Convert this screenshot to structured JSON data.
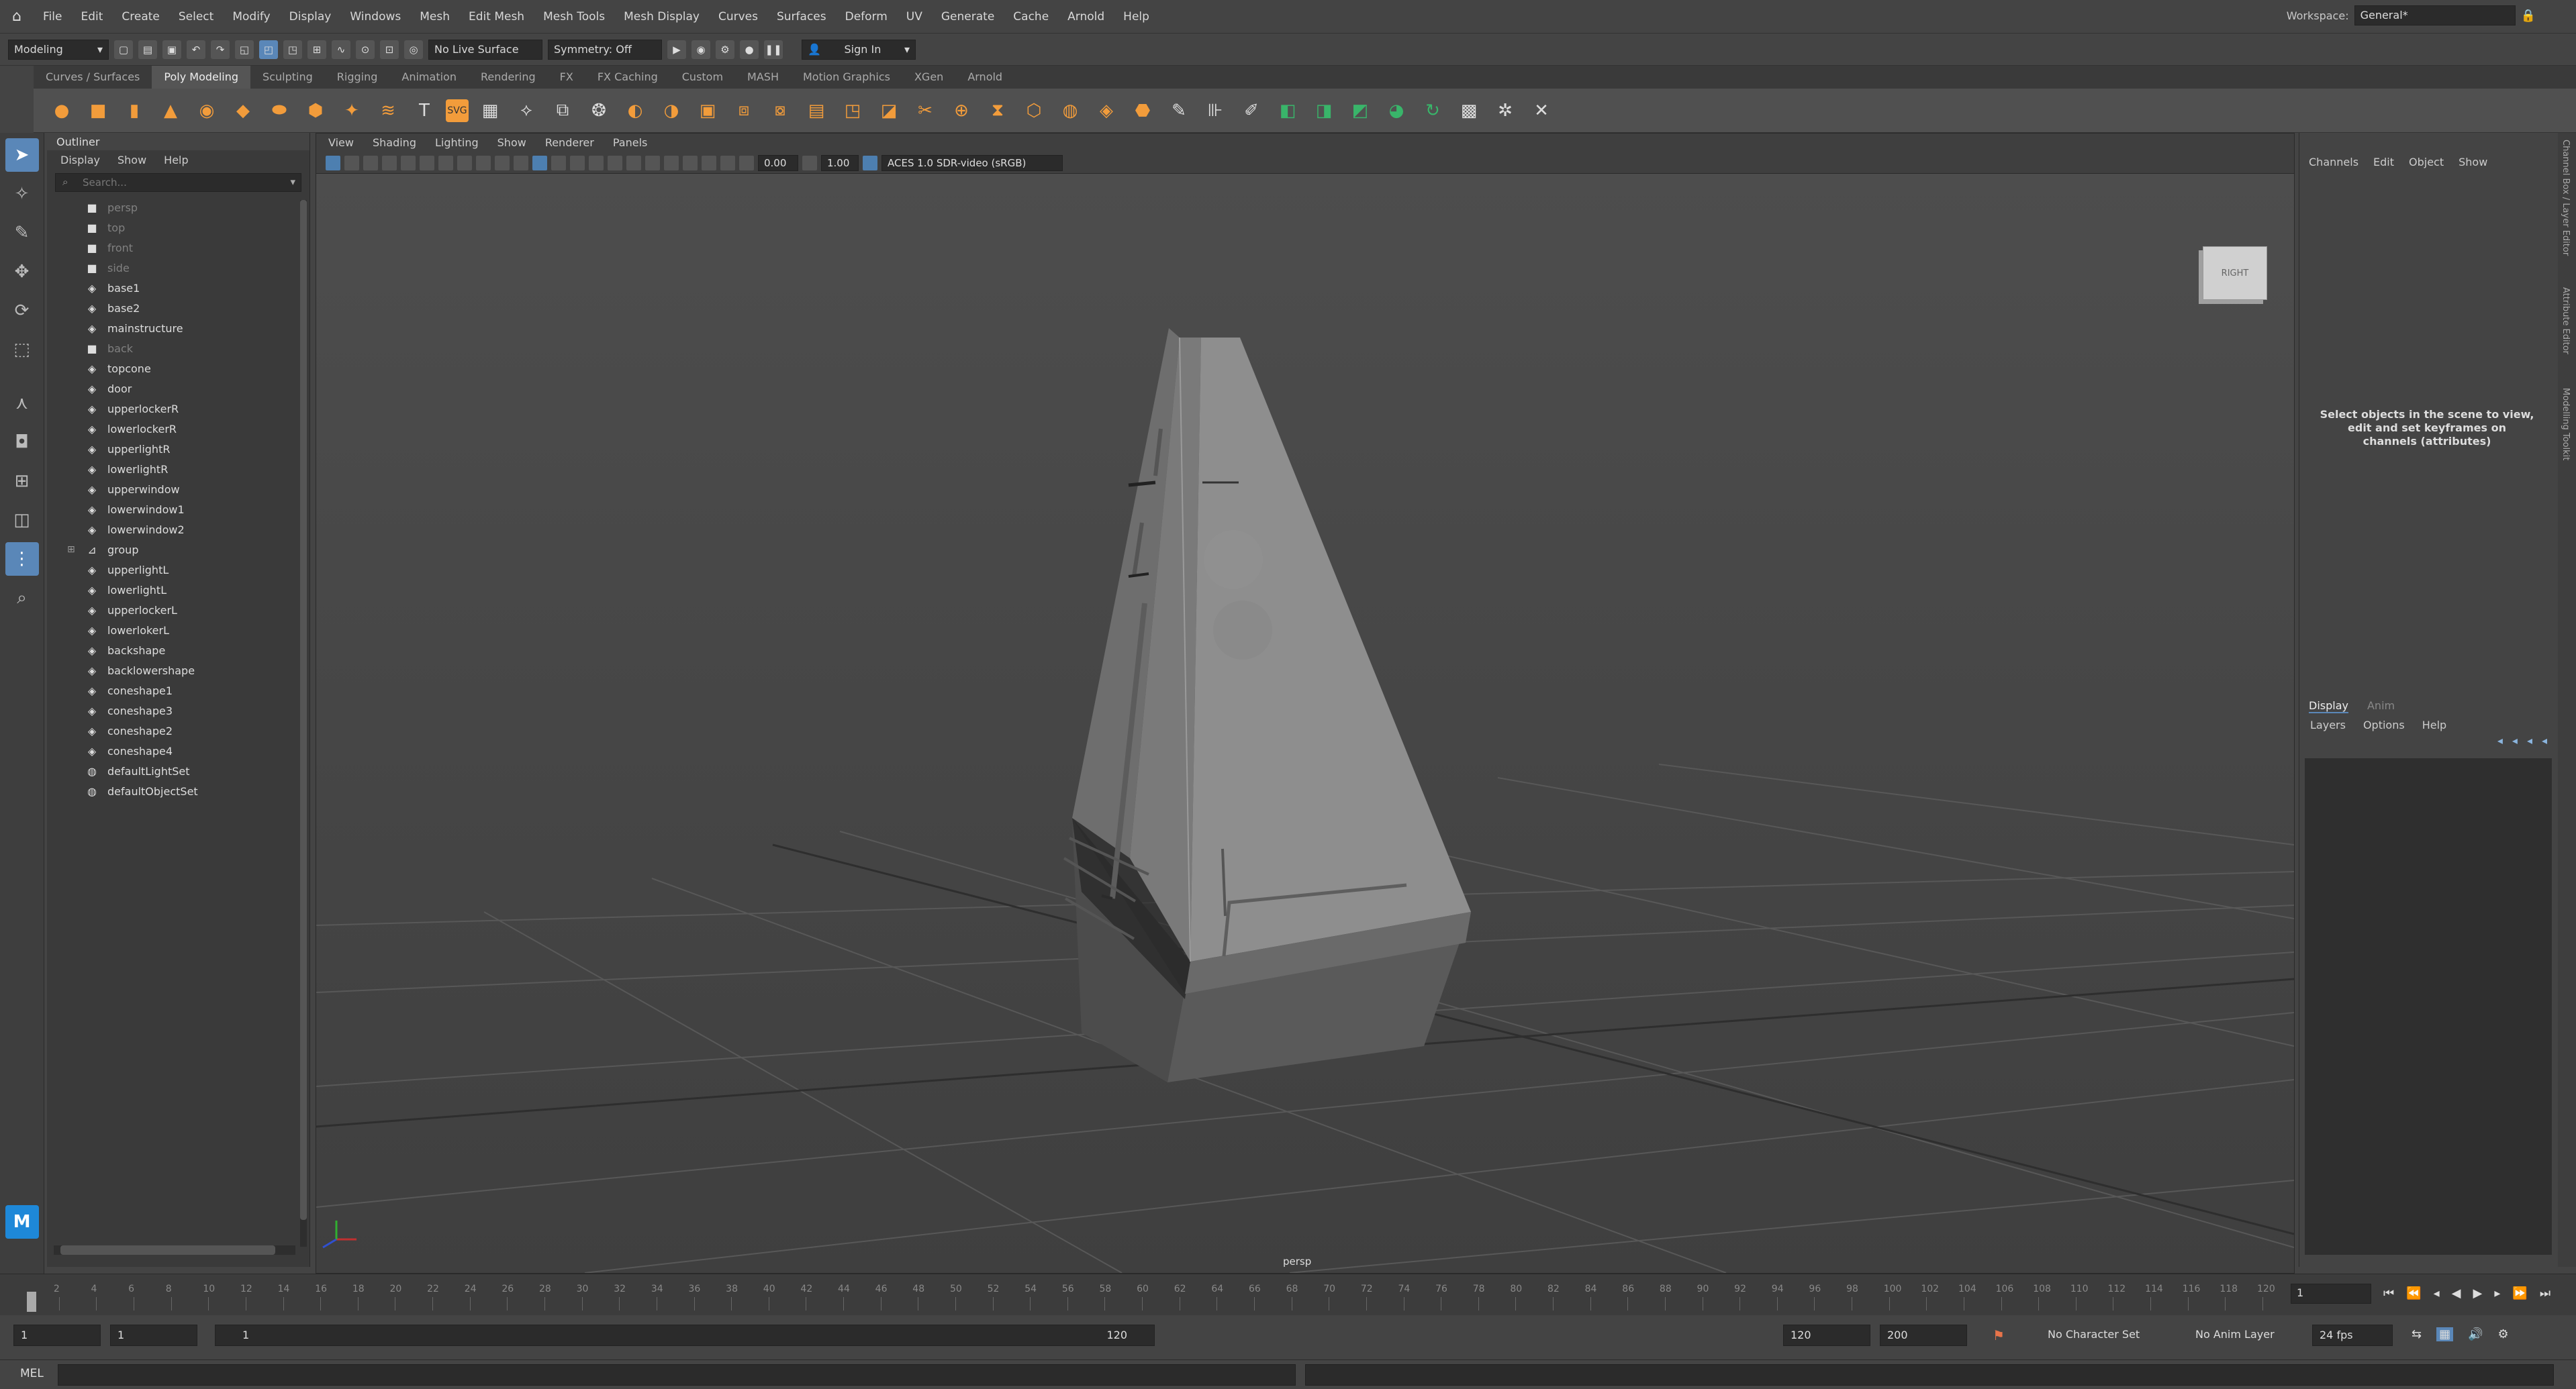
{
  "menubar": {
    "items": [
      "File",
      "Edit",
      "Create",
      "Select",
      "Modify",
      "Display",
      "Windows",
      "Mesh",
      "Edit Mesh",
      "Mesh Tools",
      "Mesh Display",
      "Curves",
      "Surfaces",
      "Deform",
      "UV",
      "Generate",
      "Cache",
      "Arnold",
      "Help"
    ],
    "workspace_label": "Workspace:",
    "workspace_value": "General*"
  },
  "statusline": {
    "mode": "Modeling",
    "live_surface": "No Live Surface",
    "symmetry": "Symmetry: Off",
    "sign_in": "Sign In"
  },
  "shelf": {
    "tabs": [
      "Curves / Surfaces",
      "Poly Modeling",
      "Sculpting",
      "Rigging",
      "Animation",
      "Rendering",
      "FX",
      "FX Caching",
      "Custom",
      "MASH",
      "Motion Graphics",
      "XGen",
      "Arnold"
    ],
    "active_tab": "Poly Modeling"
  },
  "outliner": {
    "title": "Outliner",
    "menu": [
      "Display",
      "Show",
      "Help"
    ],
    "search_placeholder": "Search...",
    "items": [
      {
        "label": "persp",
        "kind": "camera",
        "dim": true
      },
      {
        "label": "top",
        "kind": "camera",
        "dim": true
      },
      {
        "label": "front",
        "kind": "camera",
        "dim": true
      },
      {
        "label": "side",
        "kind": "camera",
        "dim": true
      },
      {
        "label": "base1",
        "kind": "mesh"
      },
      {
        "label": "base2",
        "kind": "mesh"
      },
      {
        "label": "mainstructure",
        "kind": "mesh"
      },
      {
        "label": "back",
        "kind": "camera",
        "dim": true
      },
      {
        "label": "topcone",
        "kind": "mesh"
      },
      {
        "label": "door",
        "kind": "mesh"
      },
      {
        "label": "upperlockerR",
        "kind": "mesh"
      },
      {
        "label": "lowerlockerR",
        "kind": "mesh"
      },
      {
        "label": "upperlightR",
        "kind": "mesh"
      },
      {
        "label": "lowerlightR",
        "kind": "mesh"
      },
      {
        "label": "upperwindow",
        "kind": "mesh"
      },
      {
        "label": "lowerwindow1",
        "kind": "mesh"
      },
      {
        "label": "lowerwindow2",
        "kind": "mesh"
      },
      {
        "label": "group",
        "kind": "group",
        "expandable": true
      },
      {
        "label": "upperlightL",
        "kind": "mesh"
      },
      {
        "label": "lowerlightL",
        "kind": "mesh"
      },
      {
        "label": "upperlockerL",
        "kind": "mesh"
      },
      {
        "label": "lowerlokerL",
        "kind": "mesh"
      },
      {
        "label": "backshape",
        "kind": "mesh"
      },
      {
        "label": "backlowershape",
        "kind": "mesh"
      },
      {
        "label": "coneshape1",
        "kind": "mesh"
      },
      {
        "label": "coneshape3",
        "kind": "mesh"
      },
      {
        "label": "coneshape2",
        "kind": "mesh"
      },
      {
        "label": "coneshape4",
        "kind": "mesh"
      },
      {
        "label": "defaultLightSet",
        "kind": "set"
      },
      {
        "label": "defaultObjectSet",
        "kind": "set"
      }
    ]
  },
  "viewport": {
    "menu": [
      "View",
      "Shading",
      "Lighting",
      "Show",
      "Renderer",
      "Panels"
    ],
    "exposure": "0.00",
    "gamma": "1.00",
    "colorspace": "ACES 1.0 SDR-video (sRGB)",
    "camera_label": "persp",
    "viewcube_label": "RIGHT"
  },
  "channelbox": {
    "menu": [
      "Channels",
      "Edit",
      "Object",
      "Show"
    ],
    "hint": "Select objects in the scene to view, edit and set keyframes on channels (attributes)"
  },
  "layereditor": {
    "tabs": [
      "Display",
      "Anim"
    ],
    "menu": [
      "Layers",
      "Options",
      "Help"
    ]
  },
  "sidestrip": {
    "labels": [
      "Channel Box / Layer Editor",
      "Attribute Editor",
      "Modelling Toolkit"
    ]
  },
  "timeline": {
    "ticks": [
      2,
      4,
      6,
      8,
      10,
      12,
      14,
      16,
      18,
      20,
      22,
      24,
      26,
      28,
      30,
      32,
      34,
      36,
      38,
      40,
      42,
      44,
      46,
      48,
      50,
      52,
      54,
      56,
      58,
      60,
      62,
      64,
      66,
      68,
      70,
      72,
      74,
      76,
      78,
      80,
      82,
      84,
      86,
      88,
      90,
      92,
      94,
      96,
      98,
      100,
      102,
      104,
      106,
      108,
      110,
      112,
      114,
      116,
      118,
      120
    ],
    "current_frame": "1"
  },
  "range": {
    "start": "1",
    "start_inner": "1",
    "slider_start": "1",
    "slider_end": "120",
    "end_inner": "120",
    "end": "200",
    "character_set": "No Character Set",
    "anim_layer": "No Anim Layer",
    "fps": "24 fps"
  },
  "commandline": {
    "label": "MEL"
  },
  "colors": {
    "accent": "#5a87b8",
    "shelf_orange": "#f29c3b",
    "shelf_green": "#39b56a"
  }
}
